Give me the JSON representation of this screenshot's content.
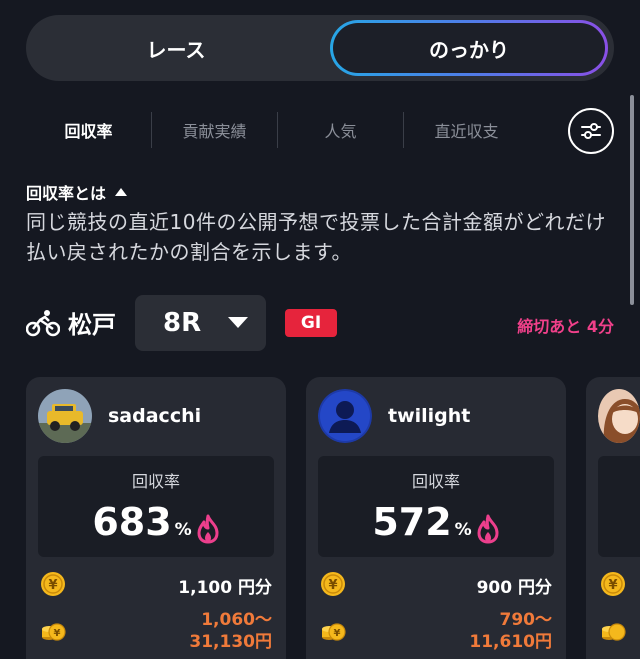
{
  "segment": {
    "left_label": "レース",
    "right_label": "のっかり",
    "active": "right"
  },
  "tabs": [
    {
      "label": "回収率",
      "active": true
    },
    {
      "label": "貢献実績",
      "active": false
    },
    {
      "label": "人気",
      "active": false
    },
    {
      "label": "直近収支",
      "active": false
    }
  ],
  "about": {
    "title": "回収率とは",
    "text": "同じ競技の直近10件の公開予想で投票した合計金額がどれだけ払い戻されたかの割合を示します。"
  },
  "race": {
    "venue": "松戸",
    "number": "8R",
    "grade": "GI",
    "deadline": "締切あと 4分"
  },
  "cards": [
    {
      "user": "sadacchi",
      "rate_label": "回収率",
      "rate": "683",
      "rate_unit": "%",
      "bet": "1,100 円分",
      "payout_line1": "1,060～",
      "payout_line2": "31,130円"
    },
    {
      "user": "twilight",
      "rate_label": "回収率",
      "rate": "572",
      "rate_unit": "%",
      "bet": "900 円分",
      "payout_line1": "790～",
      "payout_line2": "11,610円"
    }
  ],
  "colors": {
    "accent_pink": "#f0408a",
    "orange": "#f07a3a",
    "grade_red": "#e6243c",
    "coin_gold": "#f5b81c"
  },
  "icons": [
    "filter-icon",
    "caret-up-icon",
    "bicycle-icon",
    "chevron-down-icon",
    "flame-icon",
    "yen-coin-icon",
    "coin-stack-icon"
  ]
}
